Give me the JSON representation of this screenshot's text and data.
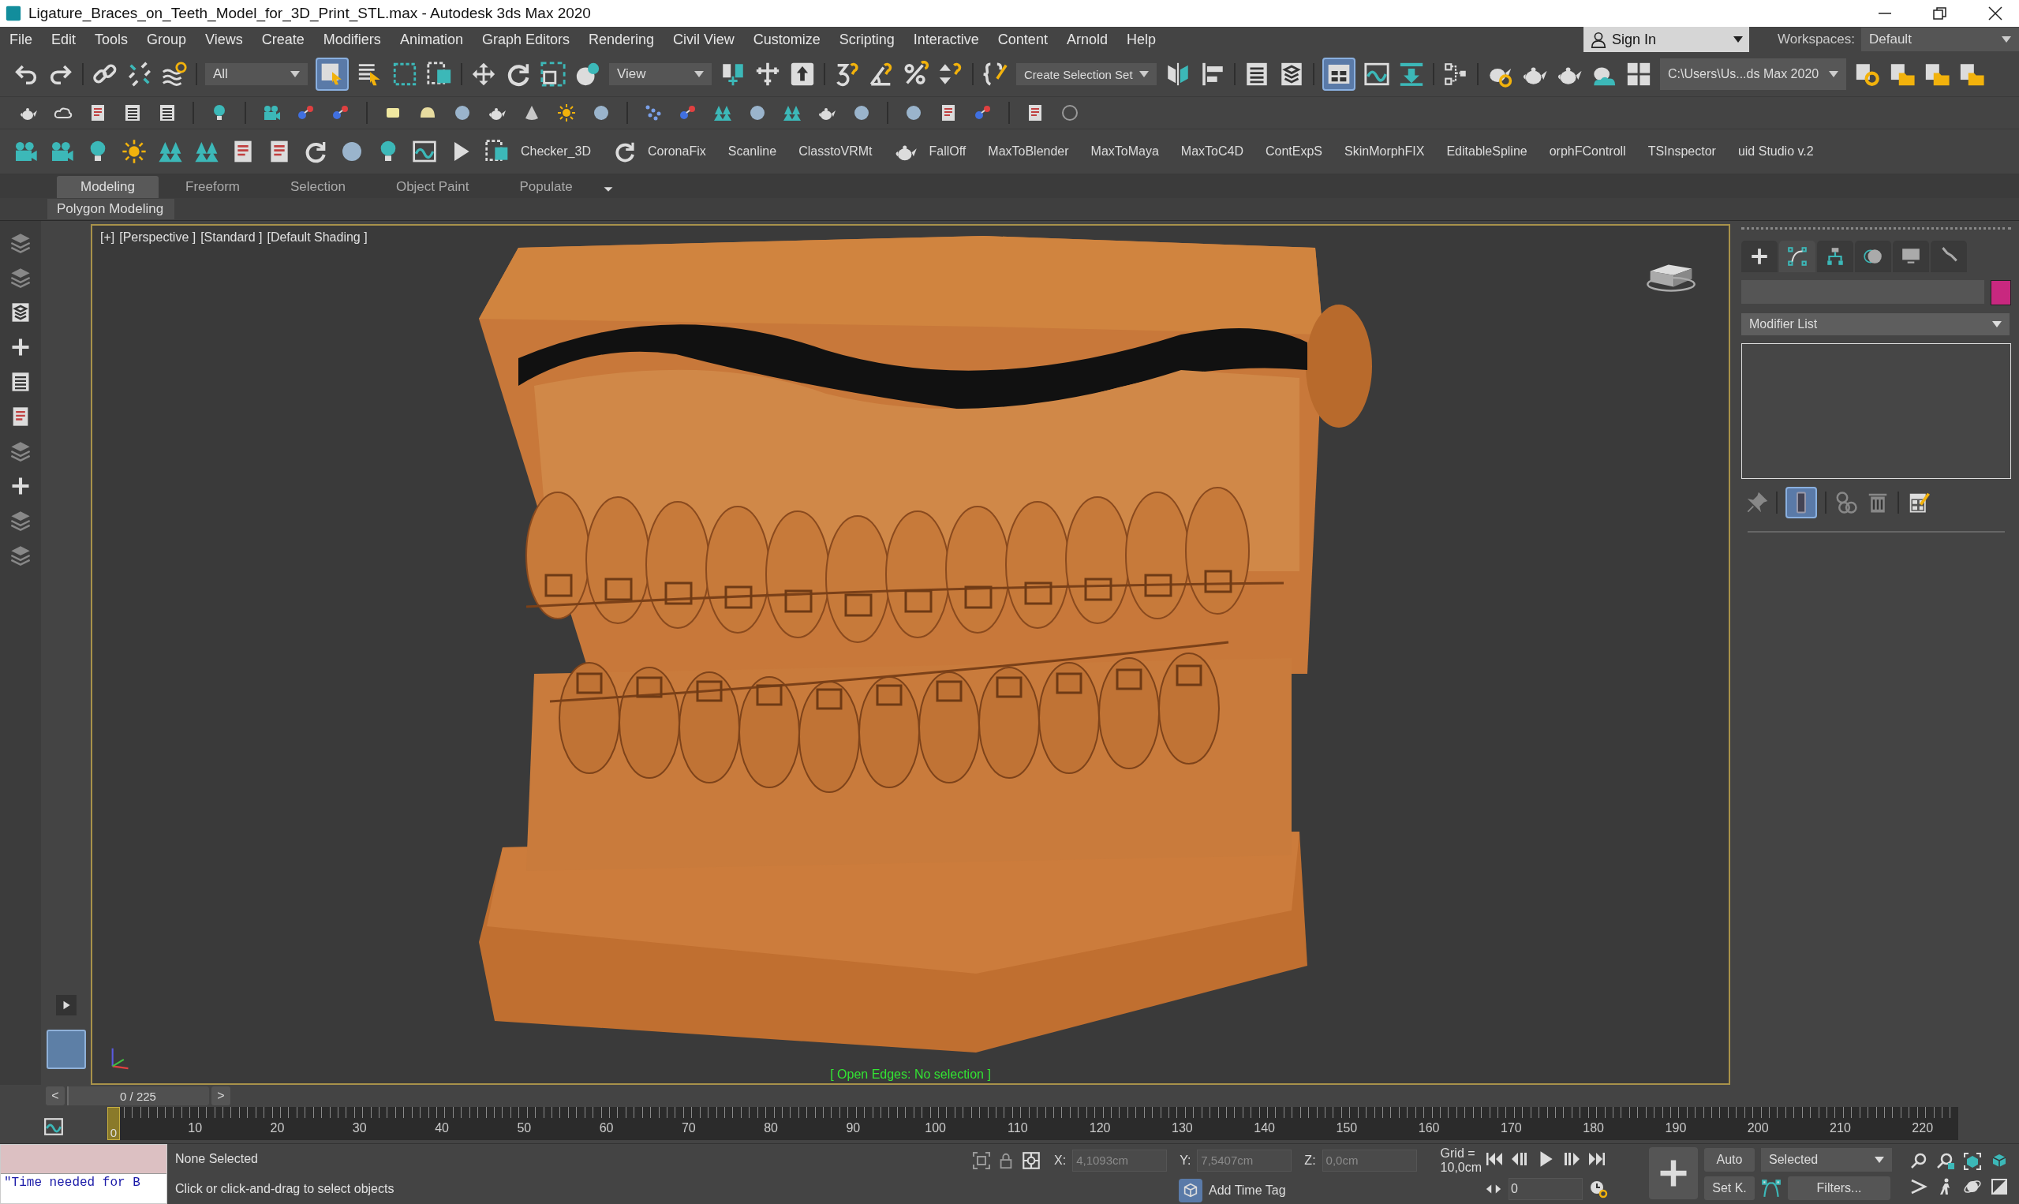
{
  "window": {
    "title": "Ligature_Braces_on_Teeth_Model_for_3D_Print_STL.max - Autodesk 3ds Max 2020"
  },
  "menu": [
    "File",
    "Edit",
    "Tools",
    "Group",
    "Views",
    "Create",
    "Modifiers",
    "Animation",
    "Graph Editors",
    "Rendering",
    "Civil View",
    "Customize",
    "Scripting",
    "Interactive",
    "Content",
    "Arnold",
    "Help"
  ],
  "account": {
    "sign_in": "Sign In",
    "workspaces_label": "Workspaces:",
    "workspace": "Default"
  },
  "main_toolbar": {
    "selection_filter": "All",
    "select_object_selected": true,
    "reference_coordinate": "View",
    "named_selection": "Create Selection Set",
    "ribbon_toggle_selected": true,
    "project_folder": "C:\\Users\\Us...ds Max 2020"
  },
  "script_bar": [
    {
      "kind": "label",
      "text": "Checker_3D"
    },
    {
      "kind": "icon"
    },
    {
      "kind": "label",
      "text": "CoronaFix"
    },
    {
      "kind": "label",
      "text": "Scanline"
    },
    {
      "kind": "label",
      "text": "ClasstoVRMt"
    },
    {
      "kind": "icon"
    },
    {
      "kind": "label",
      "text": "FallOff"
    },
    {
      "kind": "label",
      "text": "MaxToBlender"
    },
    {
      "kind": "label",
      "text": "MaxToMaya"
    },
    {
      "kind": "label",
      "text": "MaxToC4D"
    },
    {
      "kind": "label",
      "text": "ContExpS"
    },
    {
      "kind": "label",
      "text": "SkinMorphFIX"
    },
    {
      "kind": "label",
      "text": "EditableSpline"
    },
    {
      "kind": "label",
      "text": "orphFControll"
    },
    {
      "kind": "label",
      "text": "TSInspector"
    },
    {
      "kind": "label",
      "text": "uid Studio v.2"
    }
  ],
  "ribbon": {
    "tabs": [
      {
        "label": "Modeling",
        "selected": true
      },
      {
        "label": "Freeform",
        "selected": false
      },
      {
        "label": "Selection",
        "selected": false
      },
      {
        "label": "Object Paint",
        "selected": false
      },
      {
        "label": "Populate",
        "selected": false
      }
    ],
    "panel": "Polygon Modeling"
  },
  "viewport": {
    "labels": [
      "[+]",
      "[Perspective ]",
      "[Standard ]",
      "[Default Shading ]"
    ],
    "status": "[ Open Edges: No selection ]"
  },
  "command_panel": {
    "tabs": [
      {
        "kind": "create",
        "selected": false
      },
      {
        "kind": "modify",
        "selected": true
      },
      {
        "kind": "hierarchy",
        "selected": false
      },
      {
        "kind": "motion",
        "selected": false
      },
      {
        "kind": "display",
        "selected": false
      },
      {
        "kind": "utilities",
        "selected": false
      }
    ],
    "modifier_list": "Modifier List",
    "show_end_result_selected": true
  },
  "time_slider": {
    "prev": "<",
    "position": "0 / 225",
    "next": ">",
    "level": 0
  },
  "track_bar": {
    "current_frame": "0",
    "ticks": [
      "10",
      "20",
      "30",
      "40",
      "50",
      "60",
      "70",
      "80",
      "90",
      "100",
      "110",
      "120",
      "130",
      "140",
      "150",
      "160",
      "170",
      "180",
      "190",
      "200",
      "210",
      "220"
    ]
  },
  "status": {
    "listener_output": "\"Time needed for B",
    "selection": "None Selected",
    "prompt": "Click or click-and-drag to select objects",
    "coords": [
      {
        "axis": "X:",
        "value": "4,1093cm"
      },
      {
        "axis": "Y:",
        "value": "7,5407cm"
      },
      {
        "axis": "Z:",
        "value": "0,0cm"
      }
    ],
    "grid": "Grid = 10,0cm",
    "time_tag": "Add Time Tag",
    "frame": "0",
    "auto_key": "Auto",
    "set_key": "Set K.",
    "key_filter": "Selected",
    "filters": "Filters..."
  }
}
